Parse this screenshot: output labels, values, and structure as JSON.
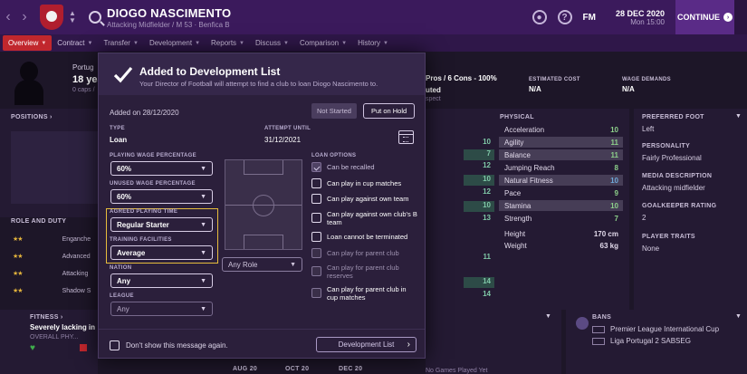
{
  "topbar": {
    "player_name": "DIOGO NASCIMENTO",
    "player_sub": "Attacking Midfielder / M 53 · Benfica B",
    "fm_label": "FM",
    "help_glyph": "?",
    "date": "28 DEC 2020",
    "day_time": "Mon 15:00",
    "continue_label": "CONTINUE"
  },
  "tabs": [
    {
      "label": "Overview",
      "active": true
    },
    {
      "label": "Contract"
    },
    {
      "label": "Transfer"
    },
    {
      "label": "Development"
    },
    {
      "label": "Reports"
    },
    {
      "label": "Discuss"
    },
    {
      "label": "Comparison"
    },
    {
      "label": "History"
    }
  ],
  "background": {
    "nation": "Portug",
    "age": "18 yea",
    "caps": "0 caps /",
    "positions_label": "POSITIONS ›",
    "role_duty_label": "ROLE AND DUTY",
    "roles": [
      "Enganche",
      "Advanced",
      "Attacking",
      "Shadow S"
    ],
    "fitness_label": "FITNESS ›",
    "fitness_text": "Severely lacking in",
    "overall_phy": "OVERALL PHY...",
    "pros_cons": "Pros / 6 Cons - 100%",
    "outed": "uted",
    "spect": "spect",
    "estimated_cost_label": "ESTIMATED COST",
    "estimated_cost_value": "N/A",
    "wage_demands_label": "WAGE DEMANDS",
    "wage_demands_value": "N/A",
    "physical_label": "PHYSICAL",
    "physical": [
      {
        "name": "Acceleration",
        "value": "10"
      },
      {
        "name": "Agility",
        "value": "11"
      },
      {
        "name": "Balance",
        "value": "11"
      },
      {
        "name": "Jumping Reach",
        "value": "8"
      },
      {
        "name": "Natural Fitness",
        "value": "10"
      },
      {
        "name": "Pace",
        "value": "9"
      },
      {
        "name": "Stamina",
        "value": "10"
      },
      {
        "name": "Strength",
        "value": "7"
      }
    ],
    "other_col": [
      "10",
      "7",
      "12",
      "10",
      "12",
      "10",
      "13"
    ],
    "height_label": "Height",
    "height_value": "170 cm",
    "weight_label": "Weight",
    "weight_value": "63 kg",
    "lower_nums": [
      "11",
      "14",
      "14"
    ],
    "pref_foot_label": "PREFERRED FOOT",
    "pref_foot_value": "Left",
    "personality_label": "PERSONALITY",
    "personality_value": "Fairly Professional",
    "media_label": "MEDIA DESCRIPTION",
    "media_value": "Attacking midfielder",
    "gk_rating_label": "GOALKEEPER RATING",
    "gk_rating_value": "2",
    "traits_label": "PLAYER TRAITS",
    "traits_value": "None",
    "bans_label": "BANS",
    "bans": [
      "Premier League International Cup",
      "Liga Portugal 2 SABSEG"
    ],
    "timeline": [
      "AUG 20",
      "OCT 20",
      "DEC 20"
    ],
    "bottom_cut": "No Games Played Yet"
  },
  "modal": {
    "title": "Added to Development List",
    "subtitle": "Your Director of Football will attempt to find a club to loan Diogo Nascimento to.",
    "added_on": "Added on 28/12/2020",
    "not_started_label": "Not Started",
    "put_on_hold_label": "Put on Hold",
    "type_label": "TYPE",
    "type_value": "Loan",
    "attempt_label": "ATTEMPT UNTIL",
    "attempt_value": "31/12/2021",
    "playing_wage_label": "PLAYING WAGE PERCENTAGE",
    "playing_wage_value": "60%",
    "unused_wage_label": "UNUSED WAGE PERCENTAGE",
    "unused_wage_value": "60%",
    "agreed_time_label": "AGREED PLAYING TIME",
    "agreed_time_value": "Regular Starter",
    "training_label": "TRAINING FACILITIES",
    "training_value": "Average",
    "nation_label": "NATION",
    "nation_value": "Any",
    "league_label": "LEAGUE",
    "league_value": "Any",
    "role_value": "Any Role",
    "loan_options_label": "LOAN OPTIONS",
    "options": [
      {
        "label": "Can be recalled",
        "state": "checked-disabled"
      },
      {
        "label": "Can play in cup matches",
        "state": "unchecked"
      },
      {
        "label": "Can play against own team",
        "state": "unchecked"
      },
      {
        "label": "Can play against own club's B team",
        "state": "unchecked"
      },
      {
        "label": "Loan cannot be terminated",
        "state": "unchecked"
      },
      {
        "label": "Can play for parent club",
        "state": "disabled"
      },
      {
        "label": "Can play for parent club reserves",
        "state": "disabled"
      },
      {
        "label": "Can play for parent club in cup matches",
        "state": "disabled-text"
      }
    ],
    "dont_show_label": "Don't show this message again.",
    "dev_list_label": "Development List"
  },
  "colors": {
    "accent_purple": "#3b1a5c",
    "tab_active": "#c1272d",
    "highlight_border": "#e6bd3c",
    "attr_green": "#8dd08a"
  }
}
